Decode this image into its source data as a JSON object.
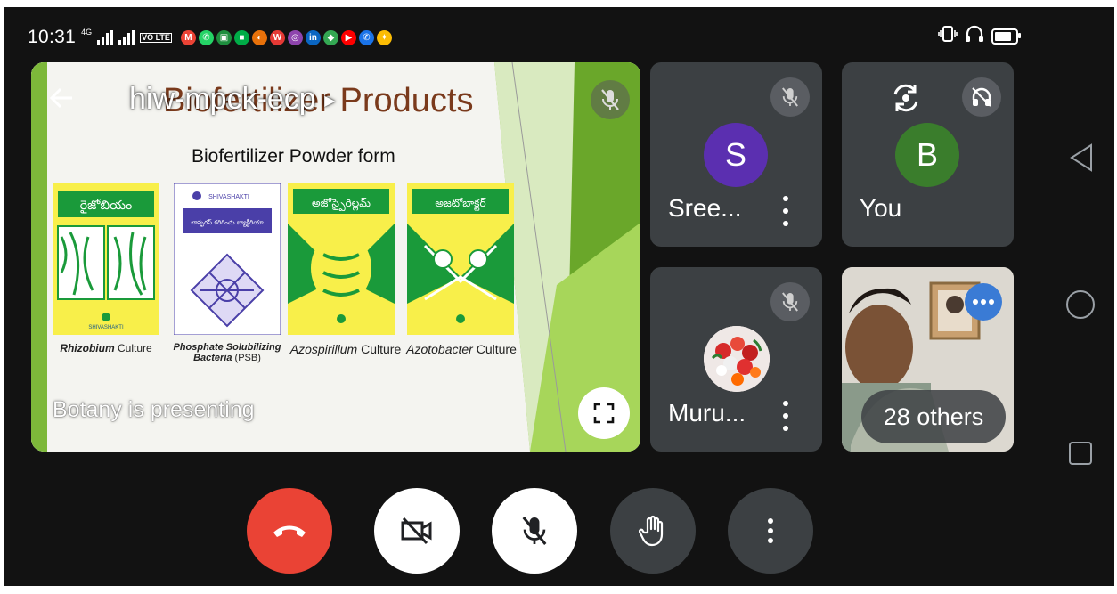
{
  "status_bar": {
    "time": "10:31",
    "net_tag": "4G",
    "volte": "VO LTE",
    "app_icons": [
      {
        "name": "gmail-icon",
        "glyph": "M",
        "color": "#ea4335"
      },
      {
        "name": "whatsapp-icon",
        "glyph": "✆",
        "color": "#25d366"
      },
      {
        "name": "classroom-icon",
        "glyph": "▣",
        "color": "#1e8e3e"
      },
      {
        "name": "meet-icon",
        "glyph": "■",
        "color": "#00ac47"
      },
      {
        "name": "edge-icon",
        "glyph": "◐",
        "color": "#e8710a"
      },
      {
        "name": "wps-icon",
        "glyph": "W",
        "color": "#e53935"
      },
      {
        "name": "instagram-icon",
        "glyph": "◎",
        "color": "#8e44ad"
      },
      {
        "name": "linkedin-icon",
        "glyph": "in",
        "color": "#0a66c2"
      },
      {
        "name": "maps-icon",
        "glyph": "◆",
        "color": "#34a853"
      },
      {
        "name": "youtube-icon",
        "glyph": "▶",
        "color": "#ff0000"
      },
      {
        "name": "phone-icon",
        "glyph": "✆",
        "color": "#1a73e8"
      },
      {
        "name": "gemini-icon",
        "glyph": "✦",
        "color": "#fbbc04"
      }
    ]
  },
  "meeting": {
    "code": "hiw-mpck-ecp",
    "presenting_label": "Botany is presenting"
  },
  "slide": {
    "title": "Biofertilizer Products",
    "subheading": "Biofertilizer Powder form",
    "packets": [
      {
        "header": "రైజోబియం",
        "color": "#1a9a3a",
        "caption_italic": "Rhizobium",
        "caption_rest": " Culture"
      },
      {
        "header": "బాస్ఫరస్ కరిగించు బ్యాక్టీరియా",
        "color": "#4a3fa8",
        "caption_italic": "Phosphate Solubilizing Bacteria",
        "caption_rest": " (PSB)"
      },
      {
        "header": "అజోస్పైరిల్లమ్",
        "color": "#1a9a3a",
        "caption_italic": "Azospirillum",
        "caption_rest": " Culture"
      },
      {
        "header": "అజటోబాక్టర్",
        "color": "#1a9a3a",
        "caption_italic": "Azotobacter",
        "caption_rest": " Culture"
      }
    ],
    "brand": "SHIVASHAKTI"
  },
  "participants": [
    {
      "name": "Sree...",
      "initial": "S",
      "avatar_color": "#5b2fb0"
    },
    {
      "name": "You",
      "initial": "B",
      "avatar_color": "#3a7d2c"
    },
    {
      "name": "Muru..."
    }
  ],
  "others_label": "28 others",
  "colors": {
    "end_call": "#ea4335",
    "tile_bg": "#3c4043",
    "control_dark": "#3c4043"
  }
}
